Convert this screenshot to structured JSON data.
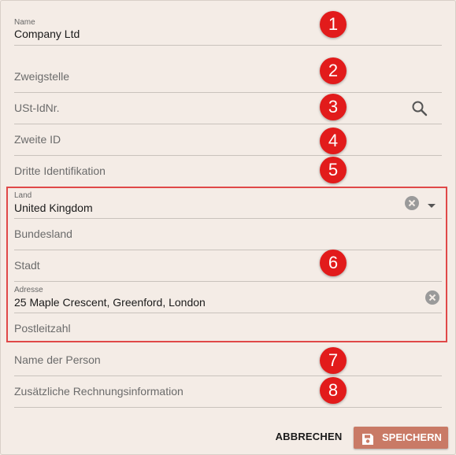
{
  "fields": {
    "name": {
      "label": "Name",
      "value": "Company Ltd"
    },
    "branch": {
      "placeholder": "Zweigstelle"
    },
    "vat": {
      "placeholder": "USt-IdNr."
    },
    "second_id": {
      "placeholder": "Zweite ID"
    },
    "third_id": {
      "placeholder": "Dritte Identifikation"
    },
    "country": {
      "label": "Land",
      "value": "United Kingdom"
    },
    "state": {
      "placeholder": "Bundesland"
    },
    "city": {
      "placeholder": "Stadt"
    },
    "address": {
      "label": "Adresse",
      "value": "25 Maple Crescent, Greenford, London"
    },
    "postal_code": {
      "placeholder": "Postleitzahl"
    },
    "person_name": {
      "placeholder": "Name der Person"
    },
    "billing_info": {
      "placeholder": "Zusätzliche Rechnungsinformation"
    }
  },
  "badges": [
    "1",
    "2",
    "3",
    "4",
    "5",
    "6",
    "7",
    "8"
  ],
  "actions": {
    "cancel": "ABBRECHEN",
    "save": "SPEICHERN"
  },
  "colors": {
    "badge": "#e21b1b",
    "group_border": "#e04848",
    "save_button": "#c97a66",
    "background": "#f4ece6"
  },
  "icons": {
    "vat_search": "search-icon",
    "country_clear": "clear-icon",
    "country_dropdown": "dropdown-arrow-icon",
    "address_clear": "clear-icon",
    "save": "floppy-disk-icon"
  }
}
